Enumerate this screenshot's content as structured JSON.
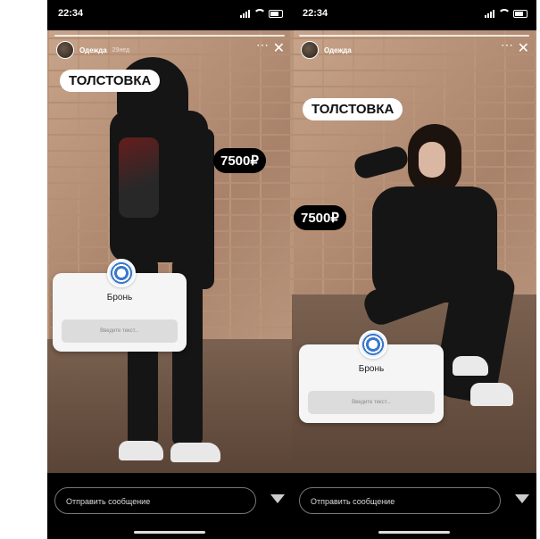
{
  "screens": [
    {
      "status": {
        "time": "22:34"
      },
      "story": {
        "username": "Одежда",
        "time_ago": "29нед"
      },
      "sticker": "ТОЛСТОВКА",
      "price": "7500₽",
      "poll": {
        "label": "Бронь",
        "placeholder": "Введите текст..."
      },
      "message_placeholder": "Отправить сообщение"
    },
    {
      "status": {
        "time": "22:34"
      },
      "story": {
        "username": "Одежда",
        "time_ago": ""
      },
      "sticker": "ТОЛСТОВКА",
      "price": "7500₽",
      "poll": {
        "label": "Бронь",
        "placeholder": "Введите текст..."
      },
      "message_placeholder": "Отправить сообщение"
    }
  ],
  "icons": {
    "more": "more-icon",
    "close": "close-icon",
    "send": "send-icon"
  },
  "colors": {
    "background": "#000000",
    "sticker": "#ffffff",
    "price_bg": "#000000",
    "poll_accent": "#3a78c9"
  }
}
